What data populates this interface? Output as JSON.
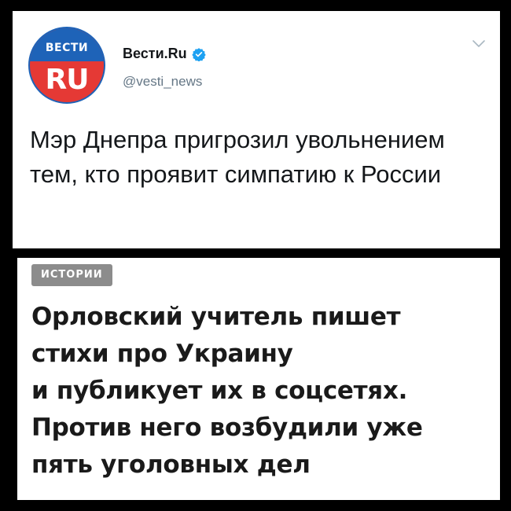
{
  "tweet": {
    "avatar": {
      "top_text": "ВЕСТИ",
      "bottom_text": "RU",
      "colors": {
        "top": "#1e63b8",
        "bottom": "#e53935"
      }
    },
    "account_name": "Вести.Ru",
    "verified_icon": "verified-badge-icon",
    "handle": "@vesti_news",
    "menu_icon": "chevron-down-icon",
    "text": "Мэр Днепра пригрозил увольнением тем, кто проявит симпатию к России",
    "colors": {
      "verified": "#1da1f2",
      "handle": "#657786"
    }
  },
  "story": {
    "badge": "ИСТОРИИ",
    "headline_lines": [
      "Орловский учитель пишет",
      "стихи про Украину",
      "и публикует их в соцсетях.",
      "Против него возбудили уже",
      "пять уголовных дел"
    ],
    "colors": {
      "badge_bg": "#8c8c8c"
    }
  }
}
